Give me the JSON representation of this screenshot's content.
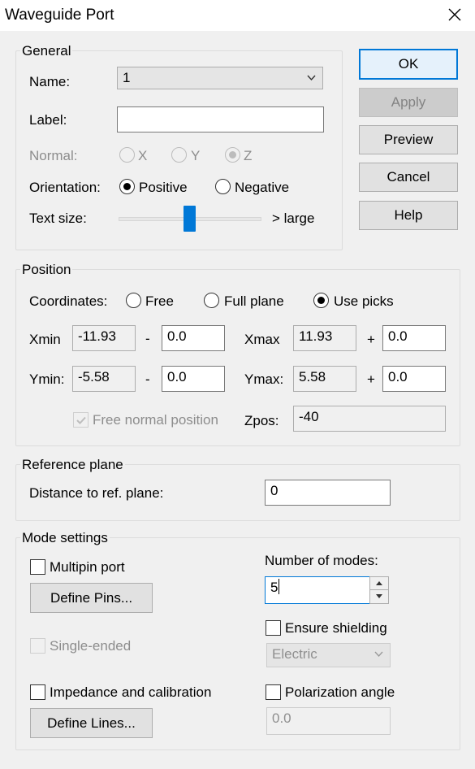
{
  "window": {
    "title": "Waveguide Port"
  },
  "buttons": {
    "ok": "OK",
    "apply": "Apply",
    "preview": "Preview",
    "cancel": "Cancel",
    "help": "Help"
  },
  "general": {
    "legend": "General",
    "name_label": "Name:",
    "name_value": "1",
    "label_label": "Label:",
    "label_value": "",
    "normal_label": "Normal:",
    "normal_options": [
      "X",
      "Y",
      "Z"
    ],
    "normal_selected": "Z",
    "orientation_label": "Orientation:",
    "orientation_options": [
      "Positive",
      "Negative"
    ],
    "orientation_selected": "Positive",
    "textsize_label": "Text size:",
    "textsize_suffix": "> large",
    "textsize_level": 0.5
  },
  "position": {
    "legend": "Position",
    "coordinates_label": "Coordinates:",
    "coordinate_options": [
      "Free",
      "Full plane",
      "Use picks"
    ],
    "coordinate_selected": "Use picks",
    "xmin_label": "Xmin",
    "xmin_value": "-11.93",
    "xmin_offset": "0.0",
    "minus": "-",
    "xmax_label": "Xmax",
    "xmax_value": "11.93",
    "xmax_offset": "0.0",
    "plus": "+",
    "ymin_label": "Ymin:",
    "ymin_value": "-5.58",
    "ymin_offset": "0.0",
    "ymax_label": "Ymax:",
    "ymax_value": "5.58",
    "ymax_offset": "0.0",
    "free_normal_label": "Free normal position",
    "free_normal_checked": true,
    "zpos_label": "Zpos:",
    "zpos_value": "-40"
  },
  "reference": {
    "legend": "Reference plane",
    "distance_label": "Distance to ref. plane:",
    "distance_value": "0"
  },
  "mode": {
    "legend": "Mode settings",
    "multipin_label": "Multipin port",
    "define_pins": "Define Pins...",
    "single_ended_label": "Single-ended",
    "impedance_label": "Impedance and calibration",
    "define_lines": "Define Lines...",
    "num_modes_label": "Number of modes:",
    "num_modes_value": "5",
    "shielding_label": "Ensure shielding",
    "shielding_value": "Electric",
    "polarization_label": "Polarization angle",
    "polarization_value": "0.0"
  }
}
